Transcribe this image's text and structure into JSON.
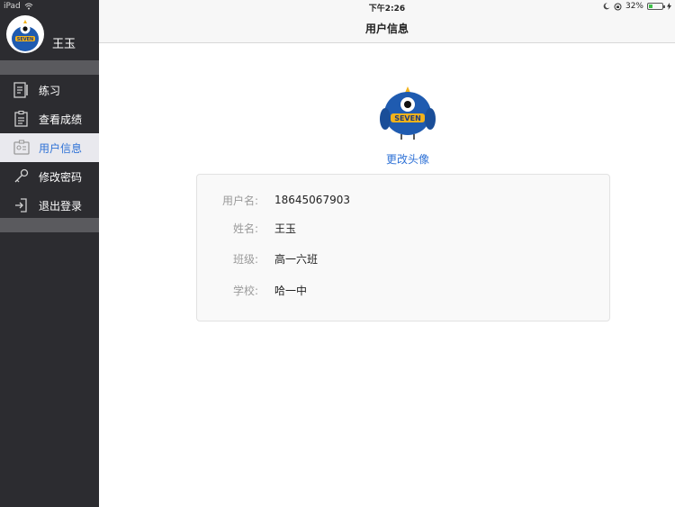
{
  "status_bar": {
    "device": "iPad",
    "time": "下午2:26",
    "battery_percent": "32%",
    "battery_level": 0.32
  },
  "sidebar": {
    "user_name": "王玉",
    "items": [
      {
        "label": "练习",
        "icon": "practice-icon",
        "active": false
      },
      {
        "label": "查看成绩",
        "icon": "clipboard-icon",
        "active": false
      },
      {
        "label": "用户信息",
        "icon": "id-card-icon",
        "active": true
      },
      {
        "label": "修改密码",
        "icon": "key-icon",
        "active": false
      },
      {
        "label": "退出登录",
        "icon": "logout-icon",
        "active": false
      }
    ]
  },
  "header": {
    "title": "用户信息"
  },
  "main": {
    "change_avatar_label": "更改头像",
    "mascot_text": "SEVEN",
    "fields": [
      {
        "label": "用户名:",
        "value": "18645067903"
      },
      {
        "label": "姓名:",
        "value": "王玉"
      },
      {
        "label": "班级:",
        "value": "高一六班"
      },
      {
        "label": "学校:",
        "value": "哈一中"
      }
    ]
  },
  "colors": {
    "sidebar_bg": "#2c2c30",
    "accent": "#2f72d6",
    "active_item_bg": "#e9e9ee"
  }
}
